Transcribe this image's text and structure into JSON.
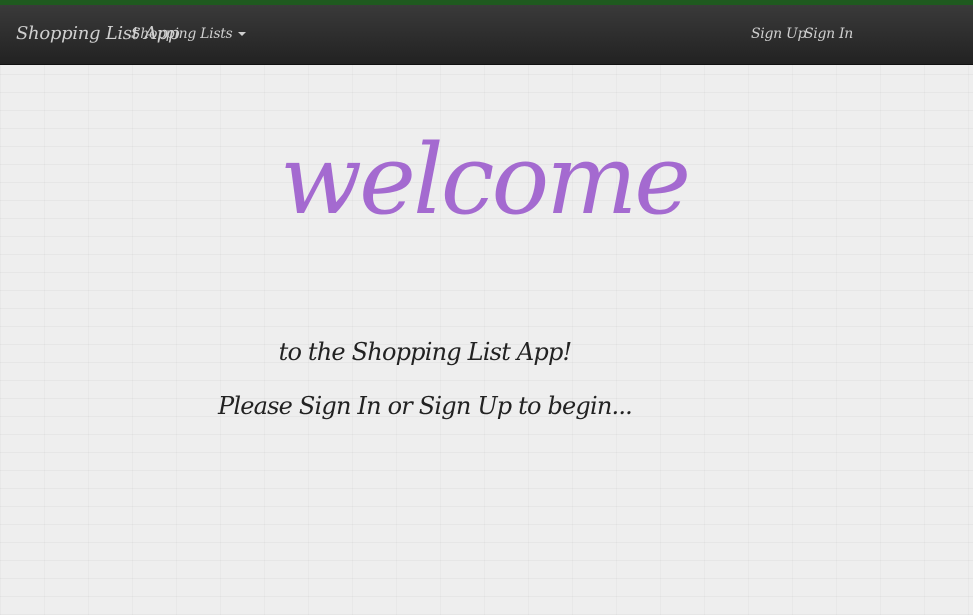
{
  "colors": {
    "accent": "#a46ad0",
    "navbar": "#2a2a2a",
    "top_strip": "#1f5a1f"
  },
  "navbar": {
    "brand": "Shopping List App",
    "dropdown_label": "Shopping Lists",
    "signup_label": "Sign Up",
    "signin_label": "Sign In"
  },
  "main": {
    "heading": "welcome",
    "line1": "to the Shopping List App!",
    "line2": "Please Sign In or Sign Up to begin..."
  }
}
